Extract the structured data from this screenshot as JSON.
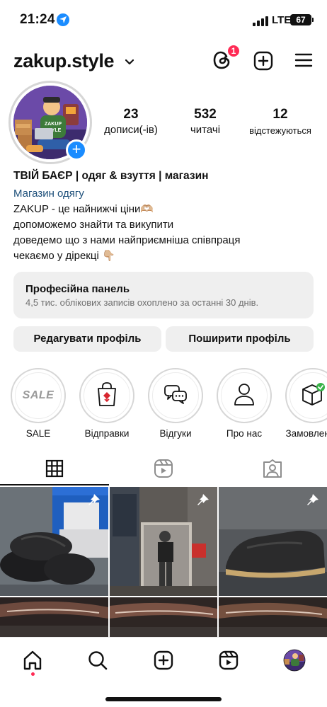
{
  "status_bar": {
    "time": "21:24",
    "network": "LTE",
    "battery": "67",
    "location_icon": "location-arrow-icon"
  },
  "header": {
    "username": "zakup.style",
    "notification_count": "1",
    "icons": [
      "chevron-down-icon",
      "threads-icon",
      "plus-square-icon",
      "menu-icon"
    ]
  },
  "profile": {
    "stats": [
      {
        "value": "23",
        "label": "дописи(-ів)"
      },
      {
        "value": "532",
        "label": "читачі"
      },
      {
        "value": "12",
        "label": "відстежуються"
      }
    ],
    "name": "ТВІЙ БАЄР | одяг & взуття | магазин",
    "category": "Магазин одягу",
    "bio_lines": [
      "ZAKUP - це найнижчі ціни🫶🏼",
      "допоможемо знайти та викупити",
      "доведемо що з нами найприємніша співпраця",
      "чекаємо у дірекці 👇🏼"
    ],
    "avatar_text": [
      "ZAKUP",
      "STYLE"
    ]
  },
  "dashboard": {
    "title": "Професійна панель",
    "subtitle": "4,5 тис. облікових записів охоплено за останні 30 днів."
  },
  "buttons": {
    "edit": "Редагувати профіль",
    "share": "Поширити профіль"
  },
  "highlights": [
    {
      "label": "SALE",
      "icon": "sale-text-icon",
      "inner_text": "SALE"
    },
    {
      "label": "Відправки",
      "icon": "shopping-bag-icon"
    },
    {
      "label": "Відгуки",
      "icon": "chat-bubbles-icon"
    },
    {
      "label": "Про нас",
      "icon": "person-icon"
    },
    {
      "label": "Замовлення",
      "icon": "package-check-icon"
    }
  ],
  "tabs": [
    "grid-icon",
    "reels-icon",
    "tagged-icon"
  ],
  "bottom_nav": [
    "home-icon",
    "search-icon",
    "create-icon",
    "reels-icon",
    "profile-avatar"
  ],
  "colors": {
    "accent_blue": "#1a8cff",
    "badge_red": "#ff2b55",
    "category_link": "#1d4f7a",
    "button_bg": "#efefef"
  }
}
